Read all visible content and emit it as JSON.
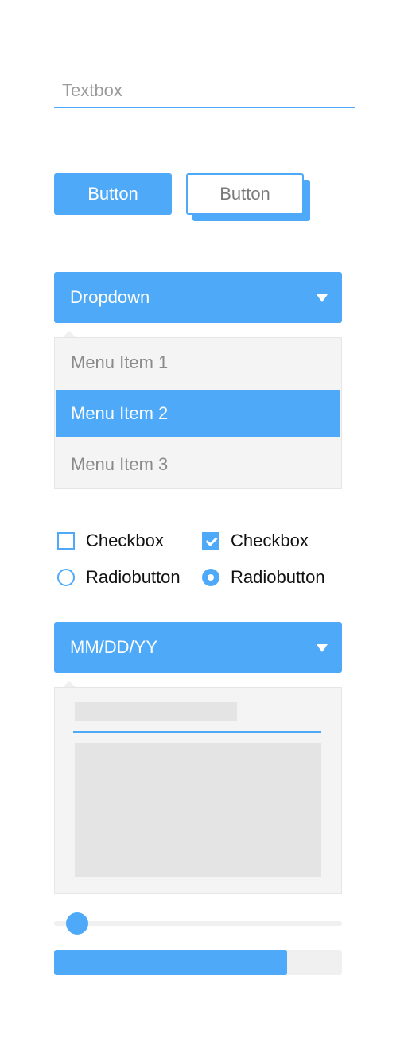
{
  "colors": {
    "accent": "#4eaaf8",
    "panel": "#f4f4f4",
    "placeholder_block": "#e4e4e4",
    "track": "#f0f0f0",
    "muted_text": "#8a8a8a"
  },
  "textbox": {
    "placeholder": "Textbox",
    "value": ""
  },
  "buttons": {
    "primary_label": "Button",
    "secondary_label": "Button"
  },
  "dropdown": {
    "label": "Dropdown",
    "icon": "caret-down-icon",
    "menu_items": [
      {
        "label": "Menu Item 1",
        "selected": false
      },
      {
        "label": "Menu Item 2",
        "selected": true
      },
      {
        "label": "Menu Item 3",
        "selected": false
      }
    ]
  },
  "checkboxes": [
    {
      "label": "Checkbox",
      "checked": false
    },
    {
      "label": "Checkbox",
      "checked": true
    }
  ],
  "radios": [
    {
      "label": "Radiobutton",
      "checked": false
    },
    {
      "label": "Radiobutton",
      "checked": true
    }
  ],
  "datepicker": {
    "label": "MM/DD/YY",
    "icon": "caret-down-icon"
  },
  "slider": {
    "value_fraction": 0.08
  },
  "progress": {
    "value_fraction": 0.81
  }
}
